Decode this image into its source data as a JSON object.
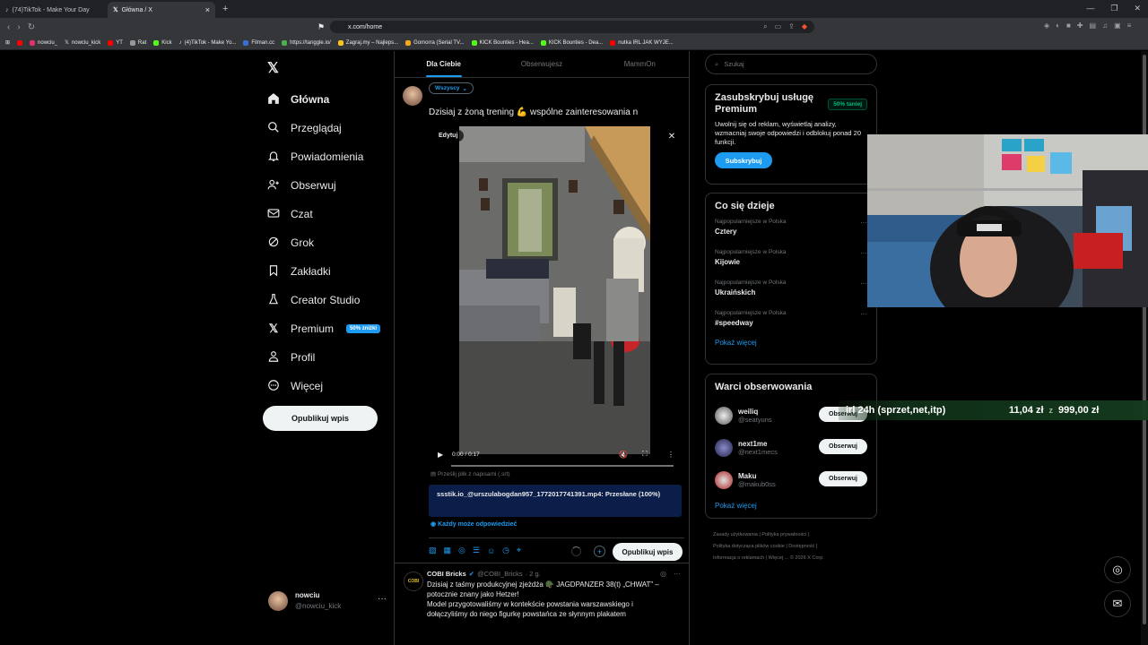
{
  "browser": {
    "tabs": [
      {
        "label": "(74)TikTok - Make Your Day"
      },
      {
        "label": "Główna / X"
      }
    ],
    "url": "x.com/home",
    "bookmarks": [
      "nowciu_",
      "nowciu_kick",
      "YT",
      "Rat",
      "Kick",
      "(4)TikTok - Make Yo...",
      "Filman.cc",
      "https://tanggle.io/",
      "Zagraj.my – Najleps...",
      "Gomorra (Serial TV...",
      "KICK Bounties - Hea...",
      "KICK Bounties - Dea...",
      "nutka IRL JAK WYJE..."
    ]
  },
  "nav": {
    "items": [
      {
        "label": "Główna",
        "icon": "home-icon"
      },
      {
        "label": "Przeglądaj",
        "icon": "search-icon"
      },
      {
        "label": "Powiadomienia",
        "icon": "bell-icon"
      },
      {
        "label": "Obserwuj",
        "icon": "add-user-icon"
      },
      {
        "label": "Czat",
        "icon": "mail-icon"
      },
      {
        "label": "Grok",
        "icon": "grok-icon"
      },
      {
        "label": "Zakładki",
        "icon": "bookmark-icon"
      },
      {
        "label": "Creator Studio",
        "icon": "flask-icon"
      },
      {
        "label": "Premium",
        "icon": "x-icon"
      },
      {
        "label": "Profil",
        "icon": "profile-icon"
      },
      {
        "label": "Więcej",
        "icon": "more-circle-icon"
      }
    ],
    "premium_badge": "50% zniżki",
    "post_button": "Opublikuj wpis",
    "account": {
      "name": "nowciu",
      "handle": "@nowciu_kick"
    }
  },
  "feed": {
    "tabs": [
      "Dla Ciebie",
      "Obserwujesz",
      "MammOn"
    ],
    "compose": {
      "audience": "Wszyscy",
      "text": "Dzisiaj z żoną trening 💪 wspólne zainteresowania n",
      "edit_label": "Edytuj",
      "video_time": "0:00 / 0:17",
      "subtitles_hint": "Prześlij plik z napisami (.srt)",
      "upload_status": "ssstik.io_@urszulabogdan957_1772017741391.mp4: Przesłane (100%)",
      "reply_setting": "Każdy może odpowiedzieć",
      "publish": "Opublikuj wpis"
    },
    "post": {
      "author": "COBI Bricks",
      "handle": "@COBI_Bricks",
      "time": "· 2 g.",
      "avatar_text": "COBI",
      "lines": [
        "Dzisiaj z taśmy produkcyjnej zjeżdża 🪖 JAGDPANZER 38(t) „CHWAT” –",
        "potocznie znany jako Hetzer!",
        "Model przygotowaliśmy w kontekście powstania warszawskiego i",
        "dołączyliśmy do niego figurkę powstańca ze słynnym plakatem"
      ]
    }
  },
  "right": {
    "search_placeholder": "Szukaj",
    "premium": {
      "title": "Zasubskrybuj usługę Premium",
      "badge": "50% taniej",
      "desc": "Uwolnij się od reklam, wyświetlaj analizy, wzmacniaj swoje odpowiedzi i odblokuj ponad 20 funkcji.",
      "button": "Subskrybuj"
    },
    "trends": {
      "title": "Co się dzieje",
      "items": [
        {
          "meta": "Najpopularniejsze w Polska",
          "name": "Cztery"
        },
        {
          "meta": "Najpopularniejsze w Polska",
          "name": "Kijowie"
        },
        {
          "meta": "Najpopularniejsze w Polska",
          "name": "Ukraińskich"
        },
        {
          "meta": "Najpopularniejsze w Polska",
          "name": "#speedway"
        }
      ],
      "show_more": "Pokaż więcej"
    },
    "follow": {
      "title": "Warci obserwowania",
      "items": [
        {
          "name": "weiliq",
          "handle": "@seatyuns",
          "button": "Obserwuj"
        },
        {
          "name": "next1me",
          "handle": "@next1mecs",
          "button": "Obserwuj"
        },
        {
          "name": "Maku",
          "handle": "@makub0ss",
          "button": "Obserwuj"
        }
      ],
      "show_more": "Pokaż więcej"
    },
    "footer": [
      "Zasady użytkowania",
      "Polityka prywatności",
      "Polityka dotycząca plików cookie",
      "Dostępność",
      "Informacja o reklamach",
      "Więcej ...",
      "© 2026 X Corp."
    ]
  },
  "overlay": {
    "ticker_goal": "irl 24h (sprzet,net,itp)",
    "ticker_current": "11,04 zł",
    "ticker_target": "999,00 zł"
  }
}
